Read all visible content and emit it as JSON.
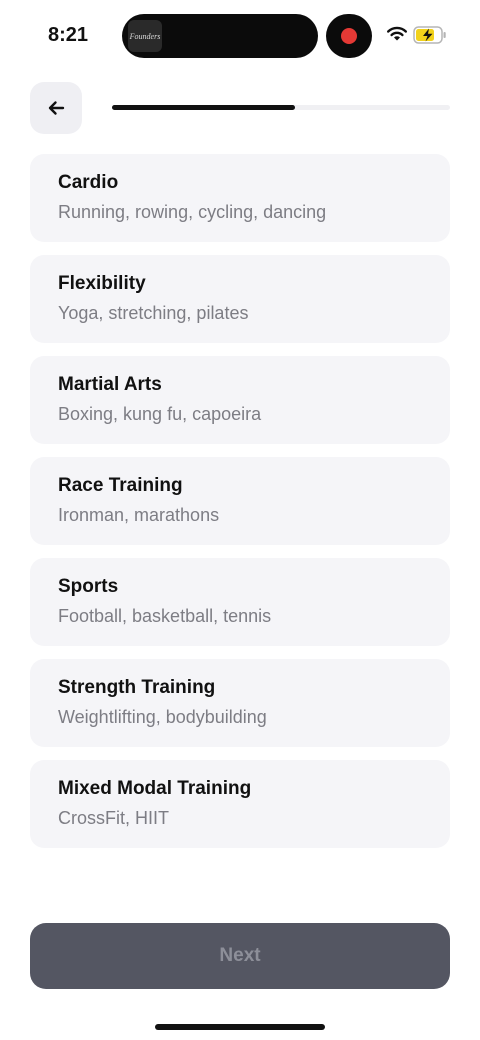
{
  "status_bar": {
    "time": "8:21",
    "island_thumbnail_text": "Founders",
    "icons": [
      "wifi-icon",
      "battery-charging-icon",
      "recording-icon"
    ]
  },
  "header": {
    "back_icon": "arrow-left-icon",
    "progress_fraction": 0.54
  },
  "options": [
    {
      "title": "Cardio",
      "subtitle": "Running, rowing, cycling, dancing"
    },
    {
      "title": "Flexibility",
      "subtitle": "Yoga, stretching, pilates"
    },
    {
      "title": "Martial Arts",
      "subtitle": "Boxing, kung fu, capoeira"
    },
    {
      "title": "Race Training",
      "subtitle": "Ironman, marathons"
    },
    {
      "title": "Sports",
      "subtitle": "Football, basketball, tennis"
    },
    {
      "title": "Strength Training",
      "subtitle": "Weightlifting, bodybuilding"
    },
    {
      "title": "Mixed Modal Training",
      "subtitle": "CrossFit, HIIT"
    }
  ],
  "footer": {
    "next_label": "Next"
  },
  "colors": {
    "accent": "#111111",
    "card_bg": "#f5f5f8",
    "button_disabled": "#545662",
    "recording": "#e53935",
    "battery_charge": "#f2d21b"
  }
}
